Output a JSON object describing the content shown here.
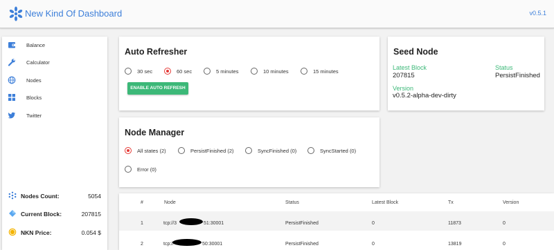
{
  "header": {
    "title": "New Kind Of Dashboard",
    "version": "v0.5.1",
    "brand_color": "#3d7fd9"
  },
  "sidebar": {
    "items": [
      {
        "label": "Balance",
        "icon": "wallet-icon"
      },
      {
        "label": "Calculator",
        "icon": "wrench-icon"
      },
      {
        "label": "Nodes",
        "icon": "globe-icon"
      },
      {
        "label": "Blocks",
        "icon": "blocks-icon"
      },
      {
        "label": "Twitter",
        "icon": "twitter-icon"
      }
    ],
    "stats": [
      {
        "label": "Nodes Count:",
        "value": "5054",
        "icon": "nodes-icon"
      },
      {
        "label": "Current Block:",
        "value": "207815",
        "icon": "block-icon"
      },
      {
        "label": "NKN Price:",
        "value": "0.054 $",
        "icon": "coin-icon"
      }
    ]
  },
  "auto_refresher": {
    "title": "Auto Refresher",
    "options": [
      "30 sec",
      "60 sec",
      "5 minutes",
      "10 minutes",
      "15 minutes"
    ],
    "selected": "60 sec",
    "button_label": "ENABLE AUTO REFRESH",
    "button_color": "#3cb878"
  },
  "seed_node": {
    "title": "Seed Node",
    "latest_block_label": "Latest Block",
    "latest_block_value": "207815",
    "status_label": "Status",
    "status_value": "PersistFinished",
    "version_label": "Version",
    "version_value": "v0.5.2-alpha-dev-dirty",
    "label_color": "#3cb878"
  },
  "node_manager": {
    "title": "Node Manager",
    "options": [
      "All states (2)",
      "PersistFinished (2)",
      "SyncFinished (0)",
      "SyncStarted (0)",
      "Error (0)"
    ],
    "selected": "All states (2)",
    "accent_color": "#e53935"
  },
  "table": {
    "columns": [
      "#",
      "Node",
      "Status",
      "Latest Block",
      "Tx",
      "Version"
    ],
    "rows": [
      {
        "index": "1",
        "node_prefix": "tcp://3",
        "node_suffix": "51:30001",
        "status": "PersistFinished",
        "latest_block": "0",
        "tx": "11873",
        "version": "0"
      },
      {
        "index": "2",
        "node_prefix": "tcp://",
        "node_suffix": "50:30001",
        "status": "PersistFinished",
        "latest_block": "0",
        "tx": "13819",
        "version": "0"
      }
    ]
  }
}
